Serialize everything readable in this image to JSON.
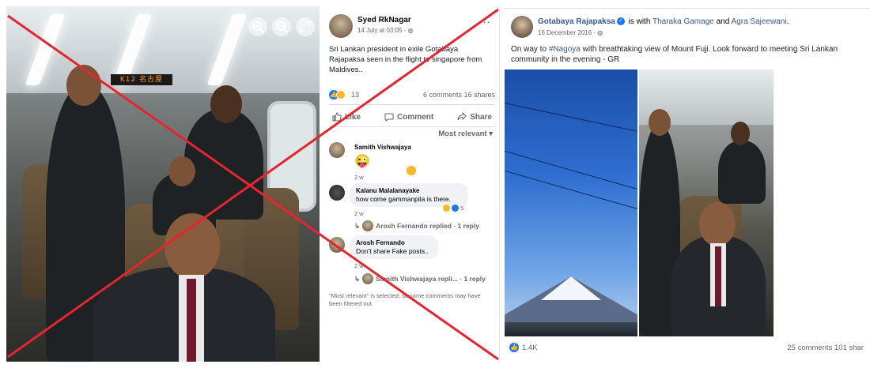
{
  "left_photo": {
    "station_sign": "K12 名古屋"
  },
  "middle_post": {
    "author": "Syed RkNagar",
    "date": "14 July at 03:05 · ",
    "caption": "Sri Lankan president in exile Gotabaya Rajapaksa seen in the flight to singapore from Maldives..",
    "reaction_count": "13",
    "comments_shares": "6 comments  16 shares",
    "actions": {
      "like": "Like",
      "comment": "Comment",
      "share": "Share"
    },
    "sort_label": "Most relevant ▾",
    "comments": [
      {
        "name": "Samith Vishwajaya",
        "text": "😜",
        "time": "2 w"
      },
      {
        "name": "Kalanu Malalanayake",
        "text": "how come gammanpila is there.",
        "time": "2 w",
        "reactions": "5"
      },
      {
        "reply_link": "Arosh Fernando replied · 1 reply"
      },
      {
        "name": "Arosh Fernando",
        "text": "Don't share Fake posts..",
        "time": "2 w"
      },
      {
        "reply_link": "Samith Vishwajaya repli... · 1 reply"
      }
    ],
    "footnote": "\"Most relevant\" is selected, so some comments may have been filtered out."
  },
  "right_post": {
    "author": "Gotabaya Rajapaksa",
    "with_text": " is with ",
    "with_1": "Tharaka Gamage",
    "and_text": " and ",
    "with_2": "Agra Sajeewani",
    "period": ".",
    "date": "16 December 2016 · ",
    "caption_pre": "On way to ",
    "hashtag": "#Nagoya",
    "caption_post": " with breathtaking view of Mount Fuji. Look forward to meeting Sri Lankan community in the evening - GR",
    "like_count": "1.4K",
    "comments_shares": "25 comments  101 shar"
  },
  "colors": {
    "fb_blue": "#1877f2",
    "link_blue": "#385898",
    "red_x": "#e3262f",
    "muted": "#65676b"
  }
}
